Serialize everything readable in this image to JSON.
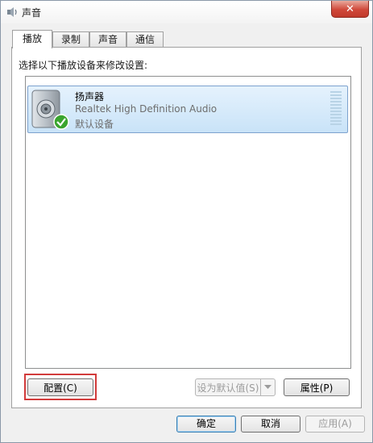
{
  "window": {
    "title": "声音",
    "close_glyph": "✕"
  },
  "tabs": [
    {
      "label": "播放"
    },
    {
      "label": "录制"
    },
    {
      "label": "声音"
    },
    {
      "label": "通信"
    }
  ],
  "playback": {
    "instruction": "选择以下播放设备来修改设置:",
    "devices": [
      {
        "name": "扬声器",
        "driver": "Realtek High Definition Audio",
        "status": "默认设备",
        "icon": "speaker-icon",
        "badge_icon": "green-check-icon"
      }
    ]
  },
  "panel_buttons": {
    "configure": "配置(C)",
    "set_default": "设为默认值(S)",
    "properties": "属性(P)"
  },
  "dialog_buttons": {
    "ok": "确定",
    "cancel": "取消",
    "apply": "应用(A)"
  },
  "colors": {
    "selection": "#cce4f7",
    "highlight_border": "#d23b3b",
    "check": "#3aa52f"
  }
}
